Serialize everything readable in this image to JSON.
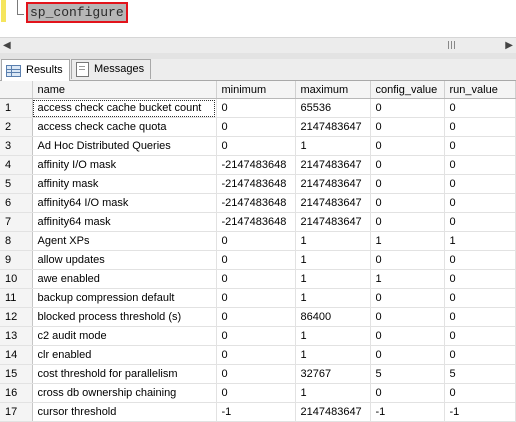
{
  "editor": {
    "query_text": "sp_configure"
  },
  "tabs": [
    {
      "label": "Results",
      "icon": "grid-icon"
    },
    {
      "label": "Messages",
      "icon": "messages-icon"
    }
  ],
  "grid": {
    "columns": [
      "",
      "name",
      "minimum",
      "maximum",
      "config_value",
      "run_value"
    ],
    "rows": [
      [
        "1",
        "access check cache bucket count",
        "0",
        "65536",
        "0",
        "0"
      ],
      [
        "2",
        "access check cache quota",
        "0",
        "2147483647",
        "0",
        "0"
      ],
      [
        "3",
        "Ad Hoc Distributed Queries",
        "0",
        "1",
        "0",
        "0"
      ],
      [
        "4",
        "affinity I/O mask",
        "-2147483648",
        "2147483647",
        "0",
        "0"
      ],
      [
        "5",
        "affinity mask",
        "-2147483648",
        "2147483647",
        "0",
        "0"
      ],
      [
        "6",
        "affinity64 I/O mask",
        "-2147483648",
        "2147483647",
        "0",
        "0"
      ],
      [
        "7",
        "affinity64 mask",
        "-2147483648",
        "2147483647",
        "0",
        "0"
      ],
      [
        "8",
        "Agent XPs",
        "0",
        "1",
        "1",
        "1"
      ],
      [
        "9",
        "allow updates",
        "0",
        "1",
        "0",
        "0"
      ],
      [
        "10",
        "awe enabled",
        "0",
        "1",
        "1",
        "0"
      ],
      [
        "11",
        "backup compression default",
        "0",
        "1",
        "0",
        "0"
      ],
      [
        "12",
        "blocked process threshold (s)",
        "0",
        "86400",
        "0",
        "0"
      ],
      [
        "13",
        "c2 audit mode",
        "0",
        "1",
        "0",
        "0"
      ],
      [
        "14",
        "clr enabled",
        "0",
        "1",
        "0",
        "0"
      ],
      [
        "15",
        "cost threshold for parallelism",
        "0",
        "32767",
        "5",
        "5"
      ],
      [
        "16",
        "cross db ownership chaining",
        "0",
        "1",
        "0",
        "0"
      ],
      [
        "17",
        "cursor threshold",
        "-1",
        "2147483647",
        "-1",
        "-1"
      ]
    ]
  },
  "colors": {
    "highlight_border": "#e2131b",
    "selection_bg": "#b6b6b6",
    "change_bar": "#f5e55d"
  }
}
